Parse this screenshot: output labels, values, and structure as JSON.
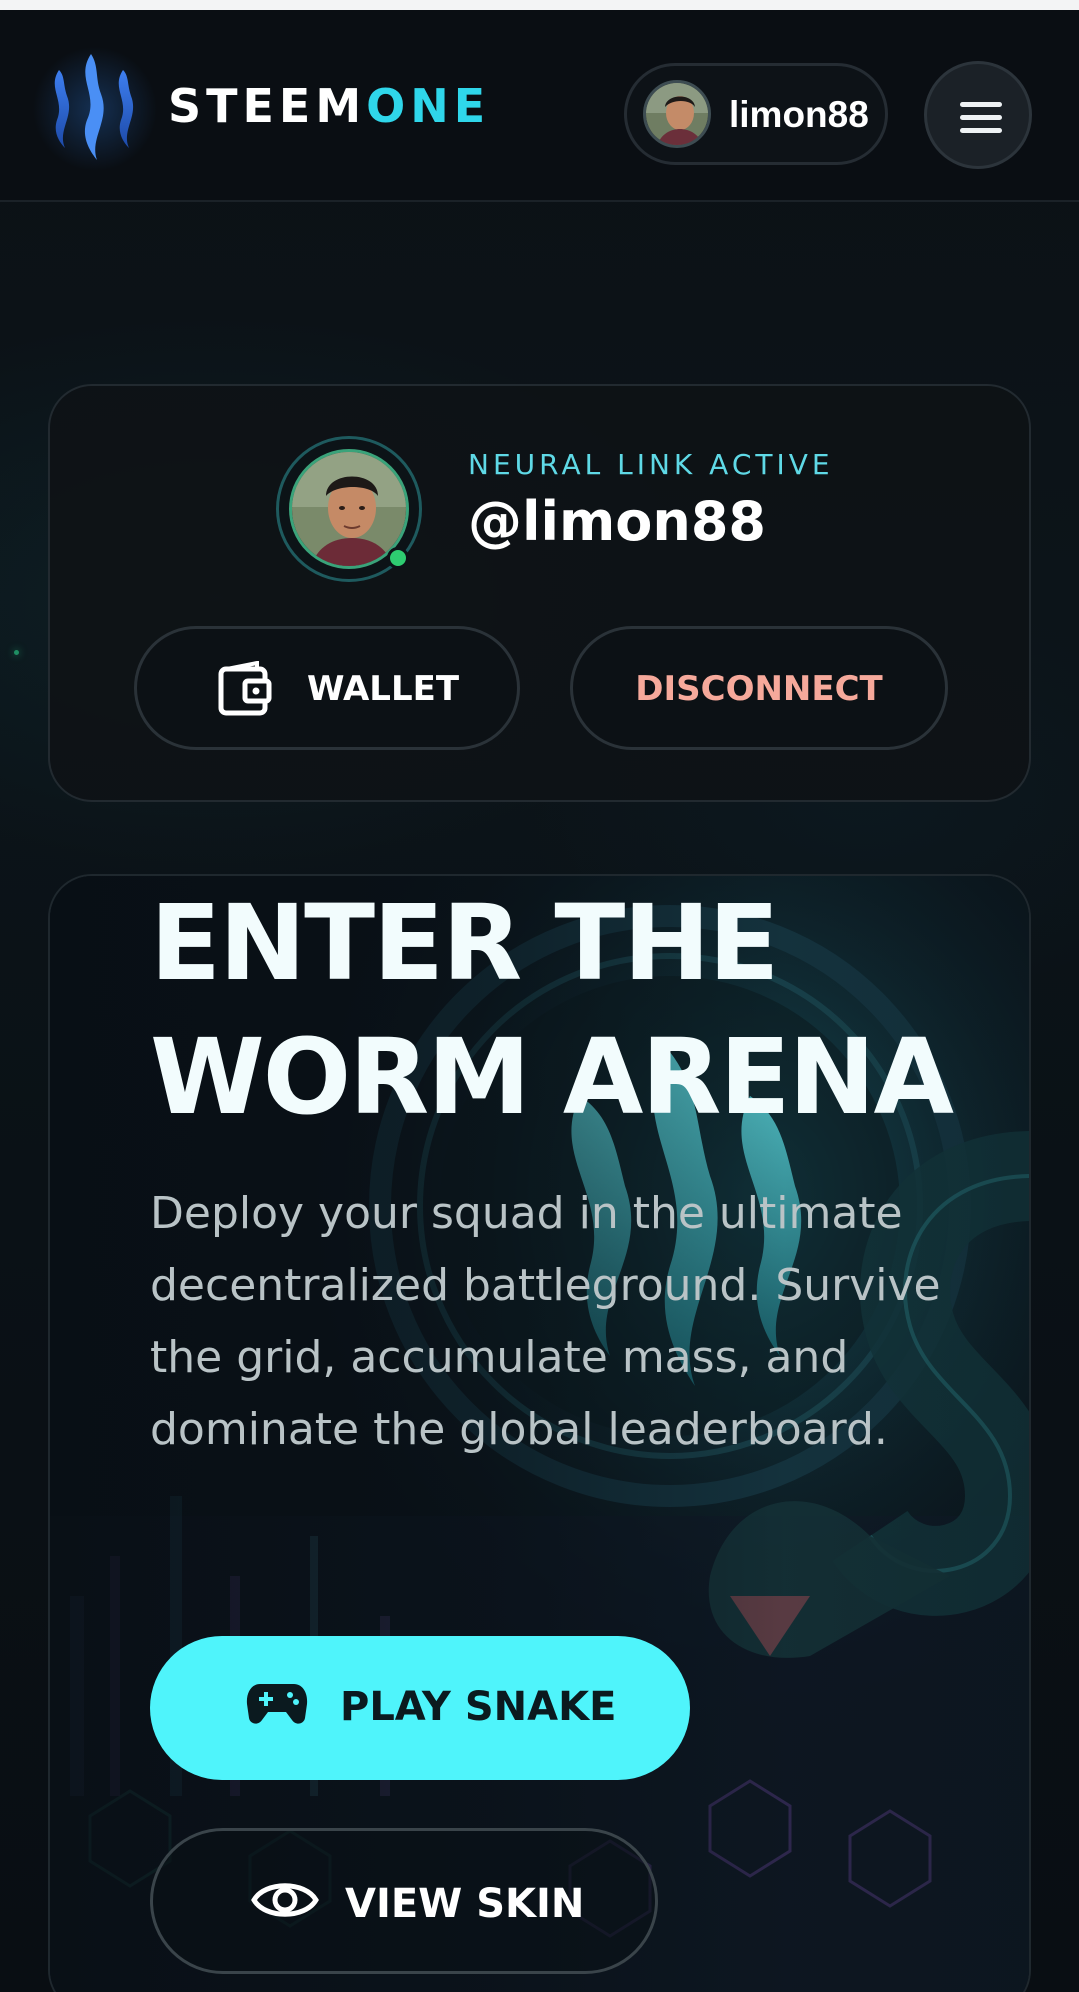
{
  "header": {
    "brand_primary": "STEEM",
    "brand_accent": "ONE",
    "username": "limon88",
    "menu_icon": "hamburger-menu-icon"
  },
  "profile": {
    "status": "NEURAL LINK ACTIVE",
    "handle": "@limon88",
    "wallet_label": "WALLET",
    "disconnect_label": "DISCONNECT"
  },
  "hero": {
    "title_line1": "ENTER THE",
    "title_line2": "WORM ARENA",
    "description": "Deploy your squad in the ultimate decentralized battleground. Survive the grid, accumulate mass, and dominate the global leaderboard.",
    "play_label": "PLAY SNAKE",
    "skin_label": "VIEW SKIN"
  },
  "colors": {
    "accent_cyan": "#2fd6ea",
    "play_button": "#4ff4fb",
    "disconnect_text": "#f6a99b",
    "online_dot": "#2ecc71"
  }
}
